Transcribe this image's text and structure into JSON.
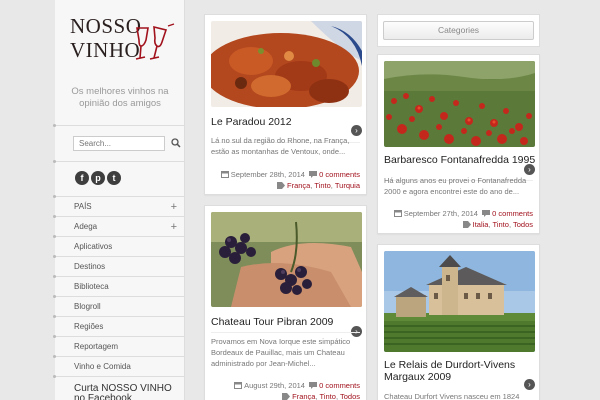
{
  "site": {
    "logo_line1": "NOSSO",
    "logo_line2": "VINHO",
    "tagline": "Os melhores vinhos na opinião dos amigos"
  },
  "search": {
    "placeholder": "Search..."
  },
  "social": [
    {
      "icon": "facebook-icon",
      "glyph": "f"
    },
    {
      "icon": "pinterest-icon",
      "glyph": "p"
    },
    {
      "icon": "twitter-icon",
      "glyph": "t"
    }
  ],
  "nav": [
    {
      "label": "PAÍS",
      "expandable": true
    },
    {
      "label": "Adega",
      "expandable": true
    },
    {
      "label": "Aplicativos",
      "expandable": false
    },
    {
      "label": "Destinos",
      "expandable": false
    },
    {
      "label": "Biblioteca",
      "expandable": false
    },
    {
      "label": "Blogroll",
      "expandable": false
    },
    {
      "label": "Regiões",
      "expandable": false
    },
    {
      "label": "Reportagem",
      "expandable": false
    },
    {
      "label": "Vinho e Comida",
      "expandable": false
    }
  ],
  "facebook_widget_title": "Curta NOSSO VINHO no Facebook",
  "categories": {
    "selected": "Categories"
  },
  "posts": [
    {
      "title": "Le Paradou 2012",
      "excerpt": "Lá no sul da região do Rhone, na França, estão as montanhas de Ventoux, onde...",
      "date": "September 28th, 2014",
      "comments": "0 comments",
      "tags": [
        "França",
        "Tinto",
        "Turquia"
      ]
    },
    {
      "title": "Barbaresco Fontanafredda 1995",
      "excerpt": "Há alguns anos eu provei o Fontanafredda 2000 e agora encontrei este do ano de...",
      "date": "September 27th, 2014",
      "comments": "0 comments",
      "tags": [
        "Italia",
        "Tinto",
        "Todos"
      ]
    },
    {
      "title": "Chateau Tour Pibran 2009",
      "excerpt": "Provamos em Nova Iorque este simpático Bordeaux de Pauillac, mais um Chateau administrado por Jean-Michel...",
      "date": "August 29th, 2014",
      "comments": "0 comments",
      "tags": [
        "França",
        "Tinto",
        "Todos"
      ]
    },
    {
      "title": "Le Relais de Durdort-Vivens Margaux 2009",
      "excerpt": "Chateau Durfort Vivens nasceu em 1824 como"
    }
  ],
  "colors": {
    "accent": "#a1121d",
    "background": "#e8e8e8"
  }
}
